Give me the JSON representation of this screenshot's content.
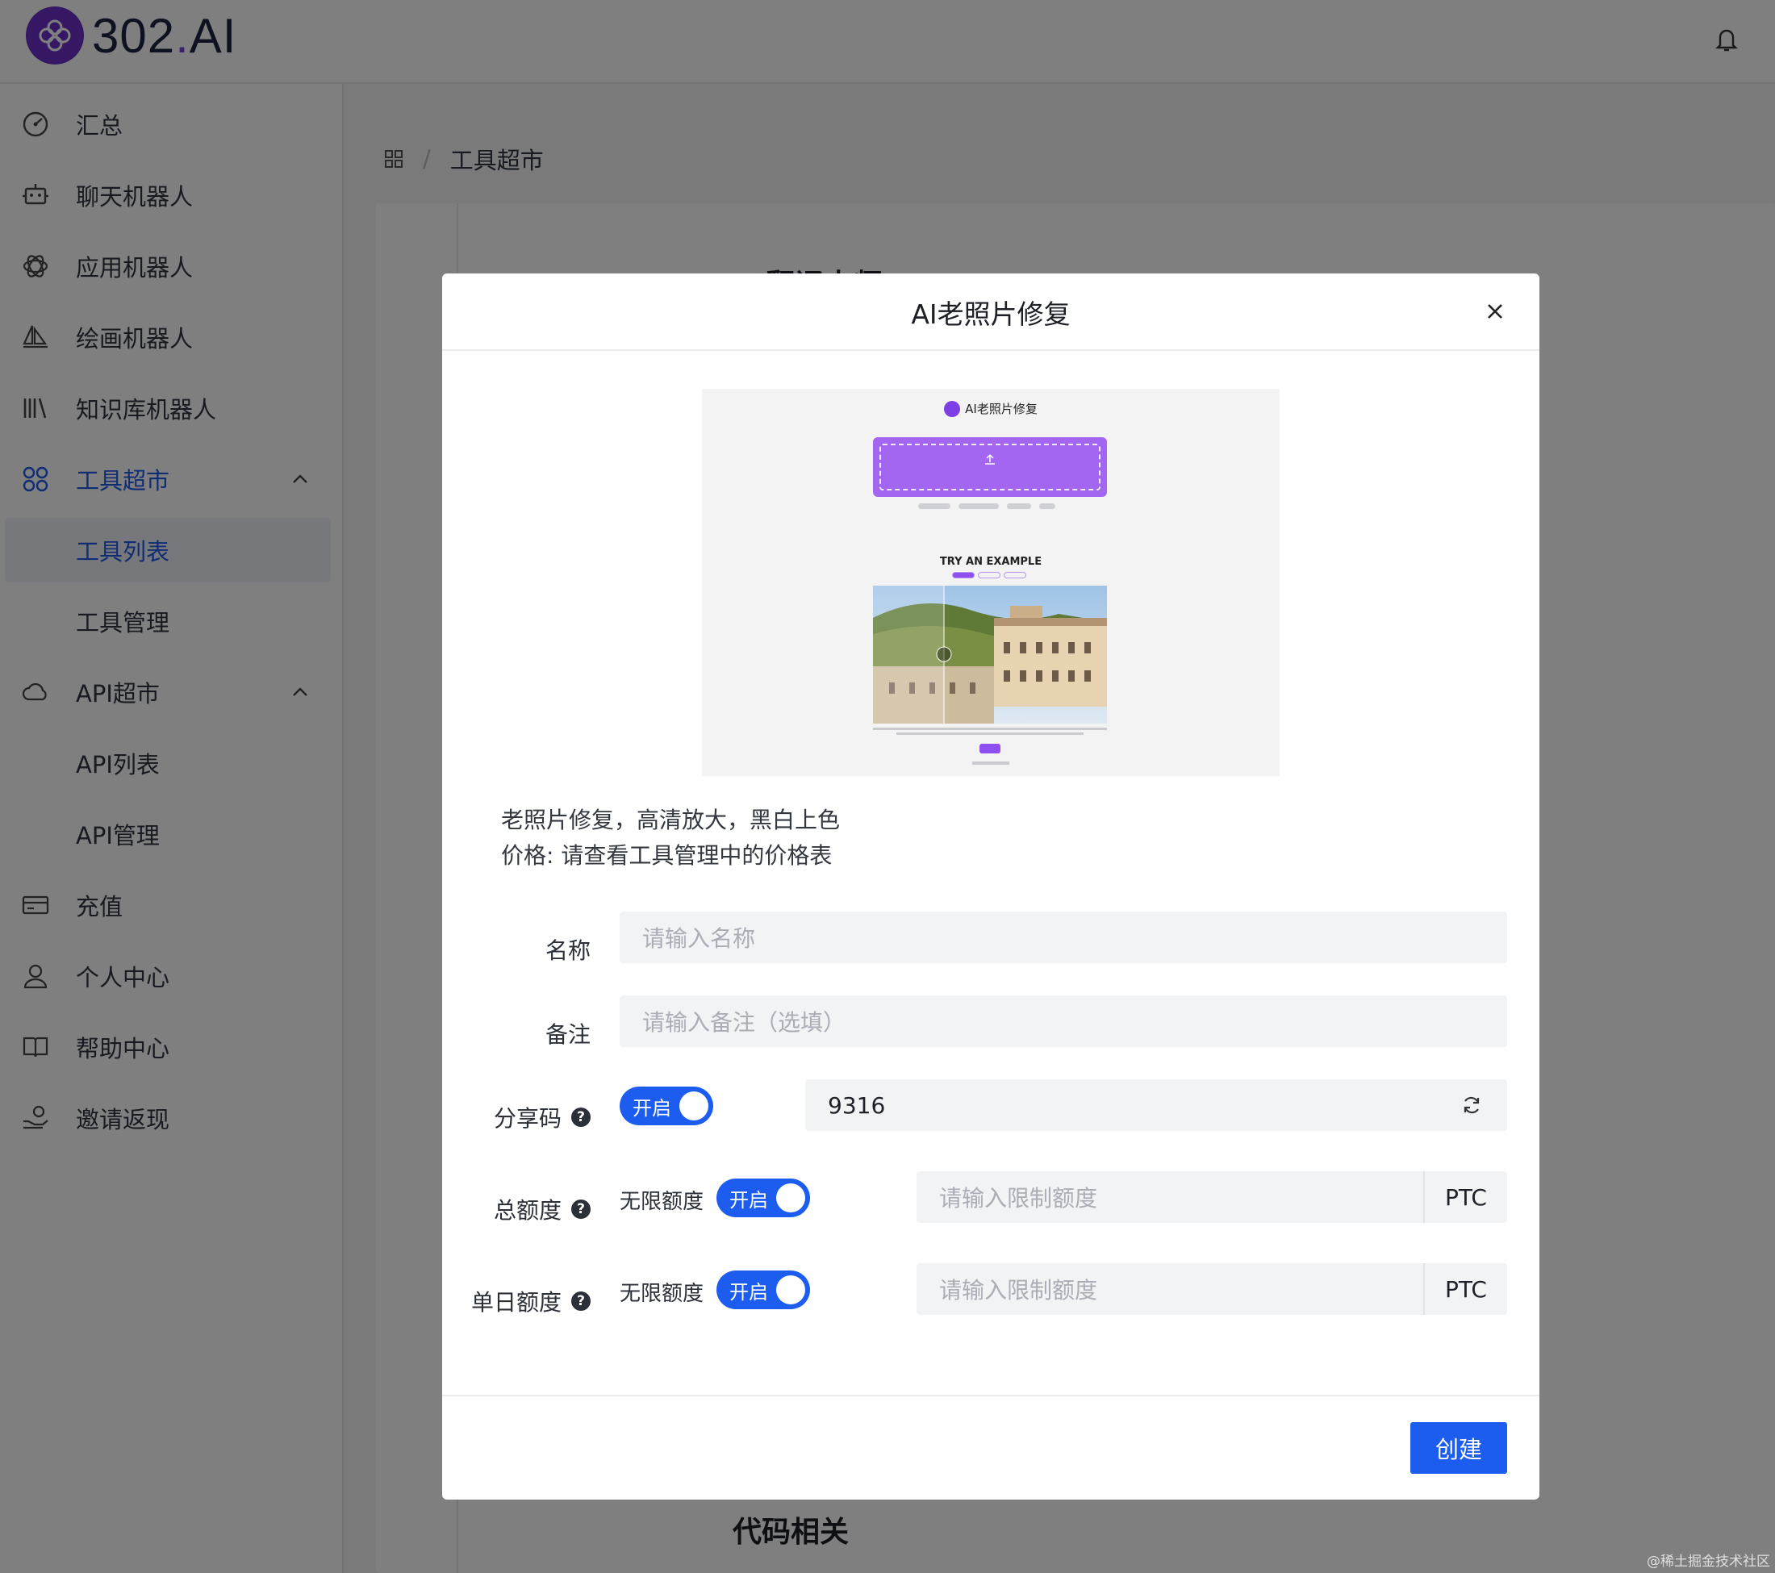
{
  "app": {
    "logo_text": "302",
    "logo_dot": ".",
    "logo_suffix": "AI"
  },
  "sidebar": {
    "items": [
      {
        "label": "汇总",
        "icon": "dashboard-icon"
      },
      {
        "label": "聊天机器人",
        "icon": "robot-icon"
      },
      {
        "label": "应用机器人",
        "icon": "openai-icon"
      },
      {
        "label": "绘画机器人",
        "icon": "sailboat-icon"
      },
      {
        "label": "知识库机器人",
        "icon": "books-icon"
      },
      {
        "label": "工具超市",
        "icon": "grid-icon",
        "expanded": true,
        "active": true
      },
      {
        "label": "工具列表",
        "sub": true,
        "selected": true
      },
      {
        "label": "工具管理",
        "sub": true
      },
      {
        "label": "API超市",
        "icon": "api-cloud-icon",
        "expanded": true
      },
      {
        "label": "API列表",
        "sub": true
      },
      {
        "label": "API管理",
        "sub": true
      },
      {
        "label": "充值",
        "icon": "card-icon"
      },
      {
        "label": "个人中心",
        "icon": "user-icon"
      },
      {
        "label": "帮助中心",
        "icon": "book-icon"
      },
      {
        "label": "邀请返现",
        "icon": "gift-hand-icon"
      }
    ]
  },
  "breadcrumb": {
    "current": "工具超市",
    "separator": "/"
  },
  "background": {
    "section_top": "AI翻译大师",
    "section_bottom": "代码相关"
  },
  "modal": {
    "title": "AI老照片修复",
    "preview": {
      "title": "AI老照片修复",
      "try_label": "TRY AN EXAMPLE"
    },
    "description_line1": "老照片修复，高清放大，黑白上色",
    "description_line2": "价格: 请查看工具管理中的价格表",
    "form": {
      "name_label": "名称",
      "name_placeholder": "请输入名称",
      "note_label": "备注",
      "note_placeholder": "请输入备注（选填）",
      "share_label": "分享码",
      "share_toggle": "开启",
      "share_code": "9316",
      "total_label": "总额度",
      "total_unlimited": "无限额度",
      "total_toggle": "开启",
      "total_placeholder": "请输入限制额度",
      "total_suffix": "PTC",
      "daily_label": "单日额度",
      "daily_unlimited": "无限额度",
      "daily_toggle": "开启",
      "daily_placeholder": "请输入限制额度",
      "daily_suffix": "PTC"
    },
    "create_button": "创建"
  },
  "watermark": "@稀土掘金技术社区",
  "colors": {
    "primary": "#1c5df0",
    "brand": "#6a2fc7",
    "preview_upload": "#a266f0"
  }
}
